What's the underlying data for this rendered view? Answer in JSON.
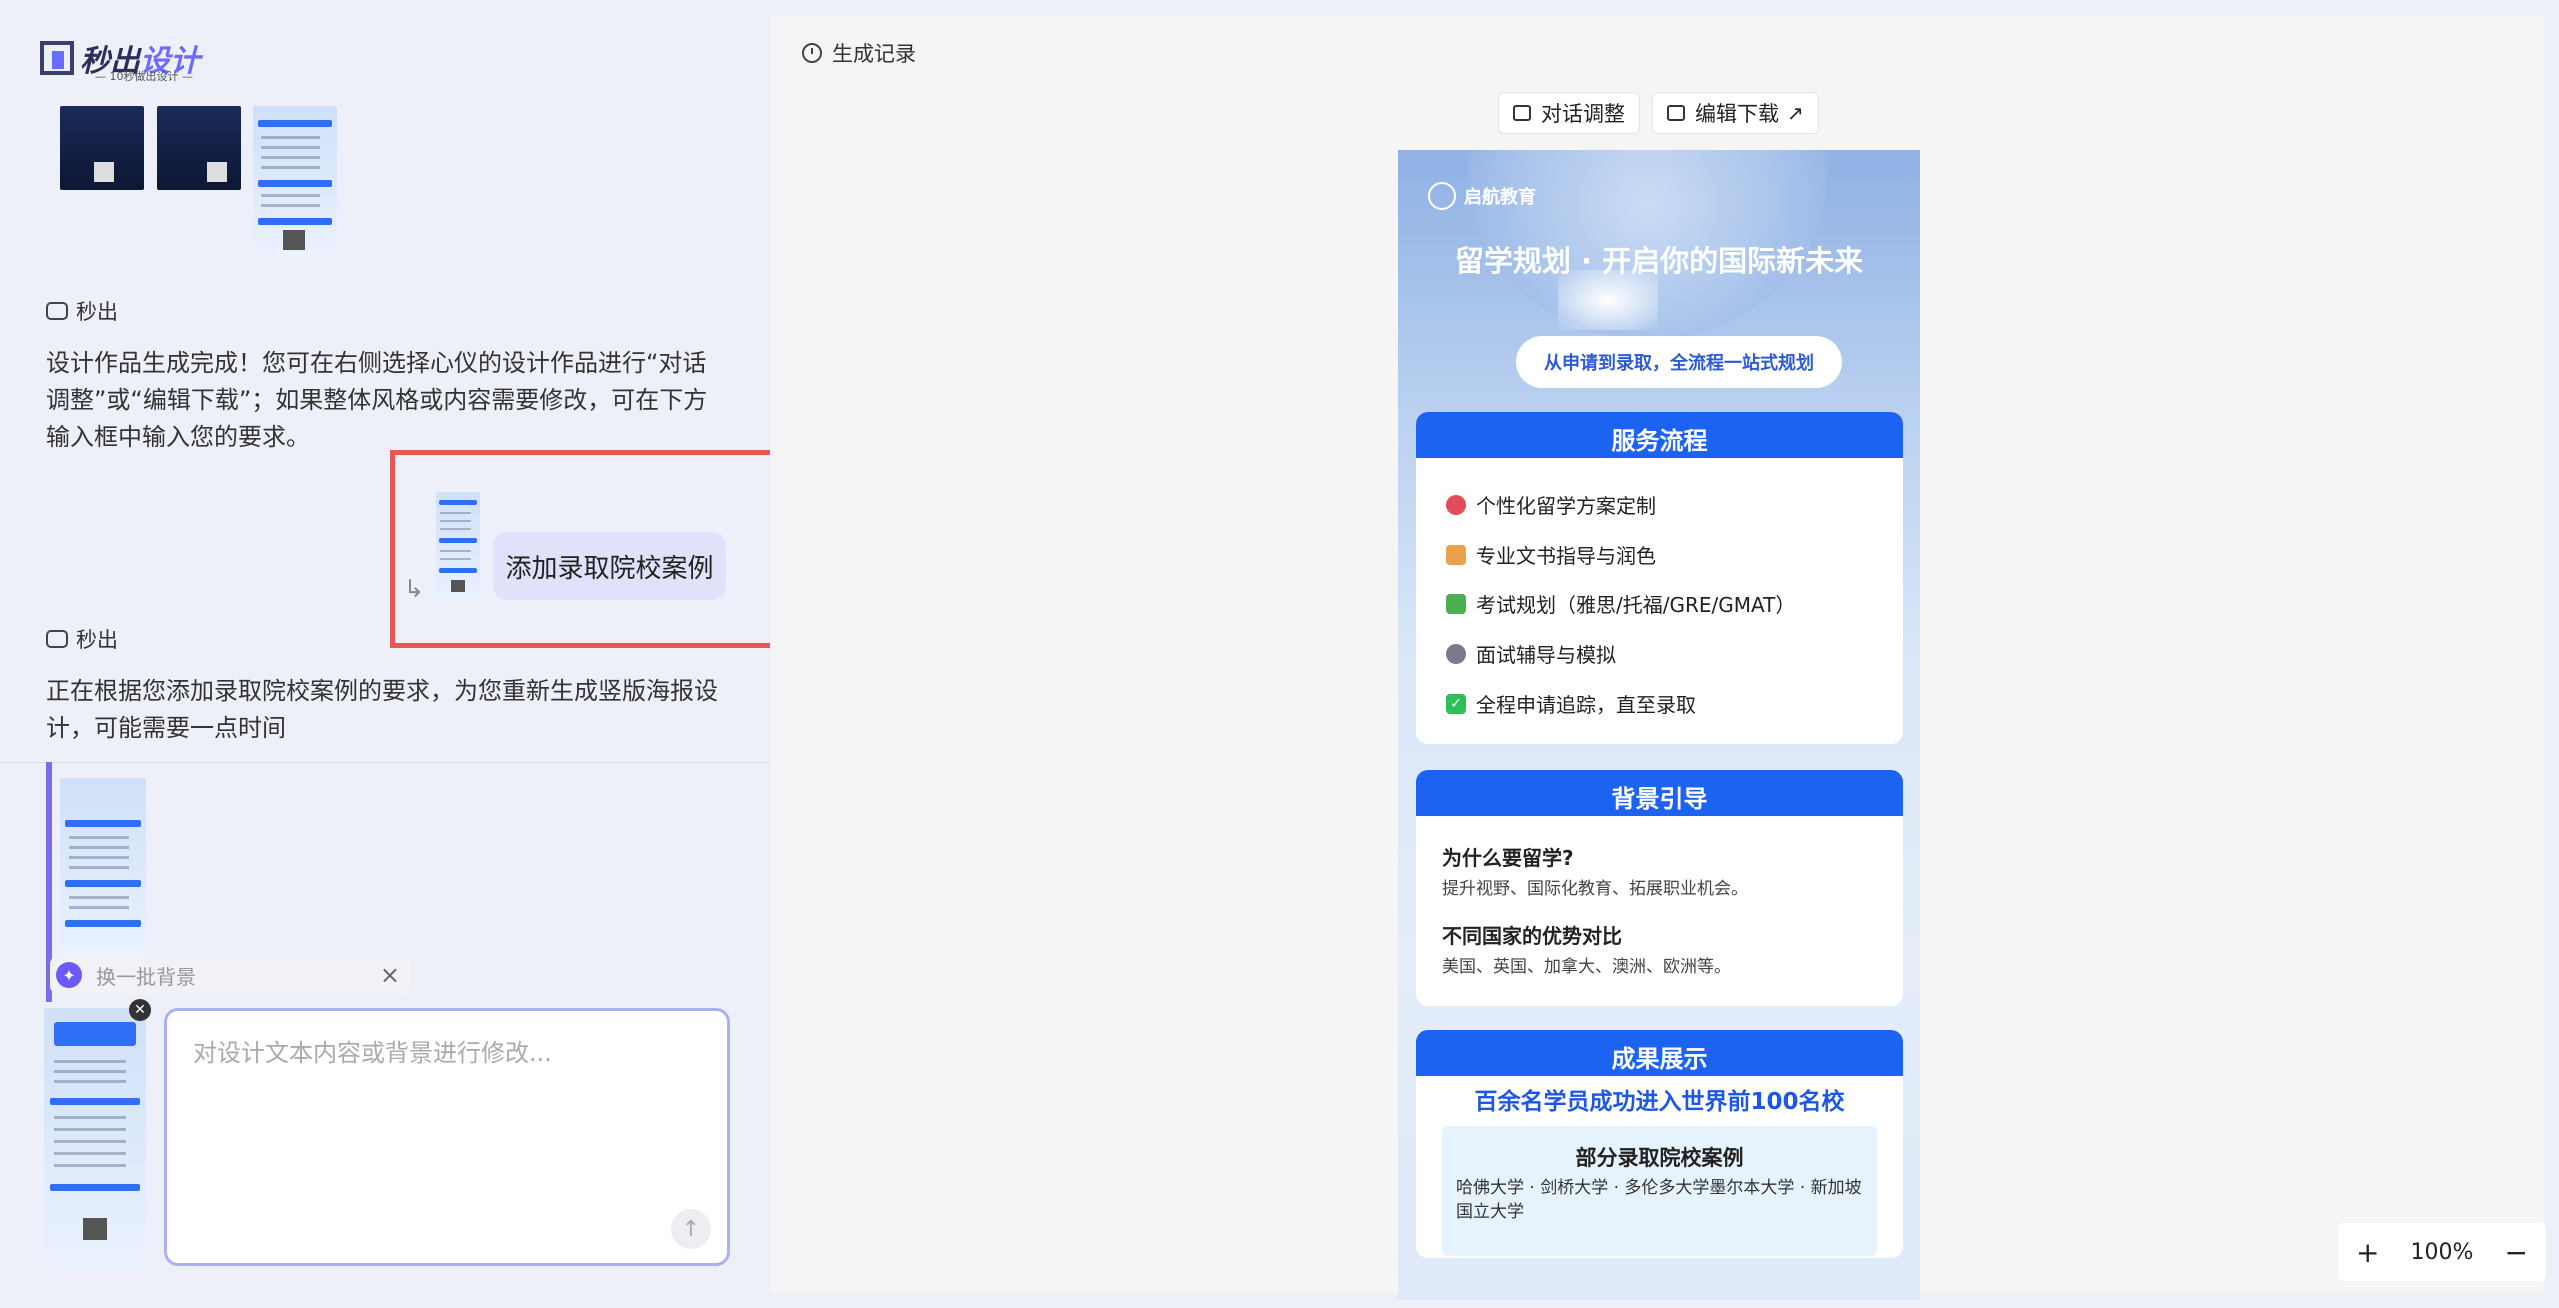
{
  "logo": {
    "part1": "秒出",
    "part2": "设计",
    "subtitle": "— 10秒做出设计 —"
  },
  "chat": {
    "bot_name": "秒出",
    "message1": "设计作品生成完成！您可在右侧选择心仪的设计作品进行“对话调整”或“编辑下载”；如果整体风格或内容需要修改，可在下方输入框中输入您的要求。",
    "user_request": "添加录取院校案例",
    "message2": "正在根据您添加录取院校案例的要求，为您重新生成竖版海报设计，可能需要一点时间",
    "chip_label": "换一批背景",
    "input_placeholder": "对设计文本内容或背景进行修改..."
  },
  "workspace": {
    "history_label": "生成记录",
    "dialog_adjust_label": "对话调整",
    "edit_download_label": "编辑下载",
    "zoom_level": "100%"
  },
  "poster": {
    "brand": "启航教育",
    "title": "留学规划 · 开启你的国际新未来",
    "pill": "从申请到录取，全流程一站式规划",
    "services_header": "服务流程",
    "services": [
      {
        "text": "个性化留学方案定制",
        "color": "#e44b5a"
      },
      {
        "text": "专业文书指导与润色",
        "color": "#e9a24b"
      },
      {
        "text": "考试规划（雅思/托福/GRE/GMAT）",
        "color": "#4caf50"
      },
      {
        "text": "面试辅导与模拟",
        "color": "#7a7a8c"
      },
      {
        "text": "全程申请追踪，直至录取",
        "color": "#2fbf5a"
      }
    ],
    "background_header": "背景引导",
    "why_q": "为什么要留学?",
    "why_a": "提升视野、国际化教育、拓展职业机会。",
    "compare_q": "不同国家的优势对比",
    "compare_a": "美国、英国、加拿大、澳洲、欧洲等。",
    "results_header": "成果展示",
    "results_title": "百余名学员成功进入世界前100名校",
    "cases_title": "部分录取院校案例",
    "cases_text": "哈佛大学 · 剑桥大学 · 多伦多大学墨尔本大学 · 新加坡国立大学"
  }
}
